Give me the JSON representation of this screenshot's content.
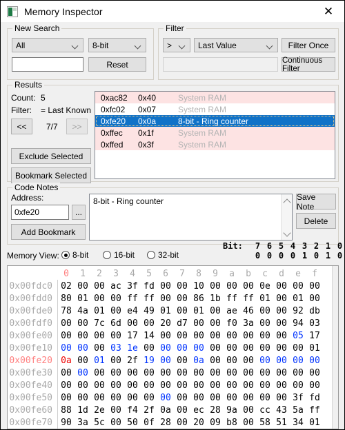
{
  "window": {
    "title": "Memory Inspector",
    "icon": "app-icon",
    "close_label": "✕"
  },
  "new_search": {
    "title": "New Search",
    "scope_value": "All",
    "size_value": "8-bit",
    "search_value": "",
    "search_placeholder": "",
    "reset_label": "Reset"
  },
  "filter": {
    "title": "Filter",
    "comparison_value": ">",
    "operand_value": "Last Value",
    "value_input": "",
    "filter_once_label": "Filter Once",
    "continuous_filter_label": "Continuous Filter"
  },
  "results": {
    "title": "Results",
    "count_label": "Count:",
    "count_value": "5",
    "filter_label": "Filter:",
    "filter_value": "= Last Known",
    "prev_label": "<<",
    "page_value": "7/7",
    "next_label": ">>",
    "exclude_label": "Exclude Selected",
    "bookmark_label": "Bookmark Selected",
    "rows": [
      {
        "address": "0xac82",
        "value": "0x40",
        "description": "System RAM",
        "style": "pink"
      },
      {
        "address": "0xfc02",
        "value": "0x07",
        "description": "System RAM",
        "style": "white"
      },
      {
        "address": "0xfe20",
        "value": "0x0a",
        "description": "8-bit - Ring counter",
        "style": "sel"
      },
      {
        "address": "0xffec",
        "value": "0x1f",
        "description": "System RAM",
        "style": "pink"
      },
      {
        "address": "0xffed",
        "value": "0x3f",
        "description": "System RAM",
        "style": "pink"
      }
    ]
  },
  "code_notes": {
    "title": "Code Notes",
    "address_label": "Address:",
    "address_value": "0xfe20",
    "browse_label": "...",
    "add_bookmark_label": "Add Bookmark",
    "note_text": "8-bit - Ring counter",
    "save_note_label": "Save Note",
    "delete_label": "Delete"
  },
  "memory_view": {
    "label": "Memory View:",
    "options": [
      "8-bit",
      "16-bit",
      "32-bit"
    ],
    "selected": "8-bit",
    "bit_label": "Bit:",
    "bit_indices": [
      "7",
      "6",
      "5",
      "4",
      "3",
      "2",
      "1",
      "0"
    ],
    "bit_values": [
      "0",
      "0",
      "0",
      "0",
      "1",
      "0",
      "1",
      "0"
    ],
    "column_headers": [
      "0",
      "1",
      "2",
      "3",
      "4",
      "5",
      "6",
      "7",
      "8",
      "9",
      "a",
      "b",
      "c",
      "d",
      "e",
      "f"
    ],
    "highlight_column": 0,
    "current_row_address": "0x00fe20",
    "colors": {
      "highlight": "#ff8080",
      "changed": "#0033ff",
      "current": "#ee0000",
      "selection": "#1072c8",
      "result_row": "#fde3e3"
    },
    "rows": [
      {
        "address": "0x00fdc0",
        "bytes": [
          "02",
          "00",
          "00",
          "ac",
          "3f",
          "fd",
          "00",
          "00",
          "10",
          "00",
          "00",
          "00",
          "0e",
          "00",
          "00",
          "00"
        ],
        "colors": [
          "",
          "",
          "",
          "",
          "",
          "",
          "",
          "",
          "",
          "",
          "",
          "",
          "",
          "",
          "",
          ""
        ]
      },
      {
        "address": "0x00fdd0",
        "bytes": [
          "80",
          "01",
          "00",
          "00",
          "ff",
          "ff",
          "00",
          "00",
          "86",
          "1b",
          "ff",
          "ff",
          "01",
          "00",
          "01",
          "00"
        ],
        "colors": [
          "",
          "",
          "",
          "",
          "",
          "",
          "",
          "",
          "",
          "",
          "",
          "",
          "",
          "",
          "",
          ""
        ]
      },
      {
        "address": "0x00fde0",
        "bytes": [
          "78",
          "4a",
          "01",
          "00",
          "e4",
          "49",
          "01",
          "00",
          "01",
          "00",
          "ae",
          "46",
          "00",
          "00",
          "92",
          "db"
        ],
        "colors": [
          "",
          "",
          "",
          "",
          "",
          "",
          "",
          "",
          "",
          "",
          "",
          "",
          "",
          "",
          "",
          ""
        ]
      },
      {
        "address": "0x00fdf0",
        "bytes": [
          "00",
          "00",
          "7c",
          "6d",
          "00",
          "00",
          "20",
          "d7",
          "00",
          "00",
          "f0",
          "3a",
          "00",
          "00",
          "94",
          "03"
        ],
        "colors": [
          "",
          "",
          "",
          "",
          "",
          "",
          "",
          "",
          "",
          "",
          "",
          "",
          "",
          "",
          "",
          ""
        ]
      },
      {
        "address": "0x00fe00",
        "bytes": [
          "00",
          "00",
          "00",
          "00",
          "17",
          "14",
          "00",
          "00",
          "00",
          "00",
          "00",
          "00",
          "00",
          "00",
          "05",
          "17"
        ],
        "colors": [
          "",
          "",
          "",
          "",
          "",
          "",
          "",
          "",
          "",
          "",
          "",
          "",
          "",
          "",
          "blue",
          ""
        ]
      },
      {
        "address": "0x00fe10",
        "bytes": [
          "00",
          "00",
          "00",
          "03",
          "1e",
          "00",
          "00",
          "00",
          "00",
          "00",
          "00",
          "00",
          "00",
          "00",
          "00",
          "01"
        ],
        "colors": [
          "blue",
          "blue",
          "",
          "blue",
          "blue",
          "",
          "blue",
          "blue",
          "blue",
          "",
          "",
          "",
          "",
          "",
          "",
          ""
        ]
      },
      {
        "address": "0x00fe20",
        "bytes": [
          "0a",
          "00",
          "01",
          "00",
          "2f",
          "19",
          "00",
          "00",
          "0a",
          "00",
          "00",
          "00",
          "00",
          "00",
          "00",
          "00"
        ],
        "colors": [
          "red",
          "",
          "blue",
          "",
          "",
          "blue",
          "blue",
          "",
          "blue",
          "",
          "",
          "",
          "blue",
          "blue",
          "blue",
          "blue"
        ],
        "current": true
      },
      {
        "address": "0x00fe30",
        "bytes": [
          "00",
          "00",
          "00",
          "00",
          "00",
          "00",
          "00",
          "00",
          "00",
          "00",
          "00",
          "00",
          "00",
          "00",
          "00",
          "00"
        ],
        "colors": [
          "",
          "blue",
          "",
          "",
          "",
          "",
          "",
          "",
          "",
          "",
          "",
          "",
          "",
          "",
          "",
          ""
        ]
      },
      {
        "address": "0x00fe40",
        "bytes": [
          "00",
          "00",
          "00",
          "00",
          "00",
          "00",
          "00",
          "00",
          "00",
          "00",
          "00",
          "00",
          "00",
          "00",
          "00",
          "00"
        ],
        "colors": [
          "",
          "",
          "",
          "",
          "",
          "",
          "",
          "",
          "",
          "",
          "",
          "",
          "",
          "",
          "",
          ""
        ]
      },
      {
        "address": "0x00fe50",
        "bytes": [
          "00",
          "00",
          "00",
          "00",
          "00",
          "00",
          "00",
          "00",
          "00",
          "00",
          "00",
          "00",
          "00",
          "00",
          "3f",
          "fd"
        ],
        "colors": [
          "",
          "",
          "",
          "",
          "",
          "",
          "blue",
          "",
          "",
          "",
          "",
          "",
          "",
          "",
          "",
          ""
        ]
      },
      {
        "address": "0x00fe60",
        "bytes": [
          "88",
          "1d",
          "2e",
          "00",
          "f4",
          "2f",
          "0a",
          "00",
          "ec",
          "28",
          "9a",
          "00",
          "cc",
          "43",
          "5a",
          "ff"
        ],
        "colors": [
          "",
          "",
          "",
          "",
          "",
          "",
          "",
          "",
          "",
          "",
          "",
          "",
          "",
          "",
          "",
          ""
        ]
      },
      {
        "address": "0x00fe70",
        "bytes": [
          "90",
          "3a",
          "5c",
          "00",
          "50",
          "0f",
          "28",
          "00",
          "20",
          "09",
          "b8",
          "00",
          "58",
          "51",
          "34",
          "01"
        ],
        "colors": [
          "",
          "",
          "",
          "",
          "",
          "",
          "",
          "",
          "",
          "",
          "",
          "",
          "",
          "",
          "",
          ""
        ]
      }
    ]
  }
}
